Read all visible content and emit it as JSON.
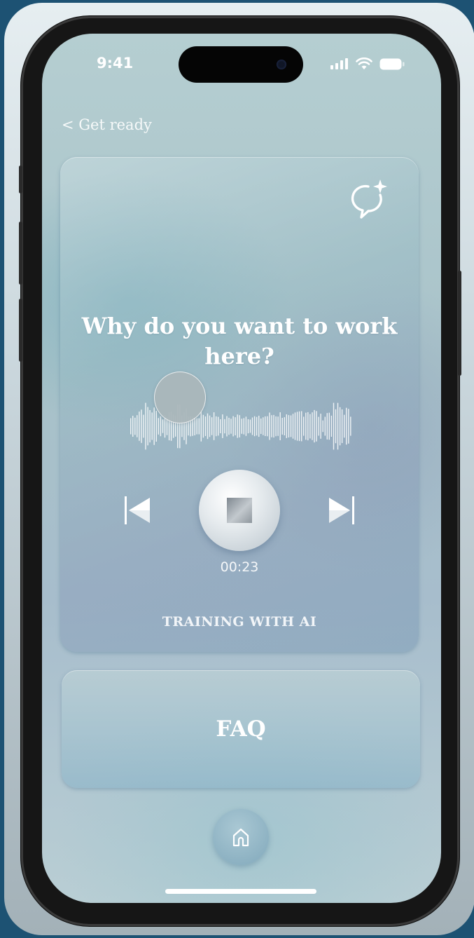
{
  "status_bar": {
    "time": "9:41"
  },
  "nav": {
    "back_label": "< Get ready"
  },
  "card": {
    "question": "Why do you want to work here?",
    "timer": "00:23",
    "mode_label": "TRAINING WITH AI",
    "icons": {
      "ai": "chat-sparkle-icon",
      "prev": "skip-back-icon",
      "stop": "stop-icon",
      "next": "skip-forward-icon"
    }
  },
  "faq": {
    "label": "FAQ"
  },
  "tab_bar": {
    "home_icon": "home-icon"
  },
  "colors": {
    "background": "#1d5273",
    "text": "#ffffff",
    "screen": "#a8c2c9"
  }
}
